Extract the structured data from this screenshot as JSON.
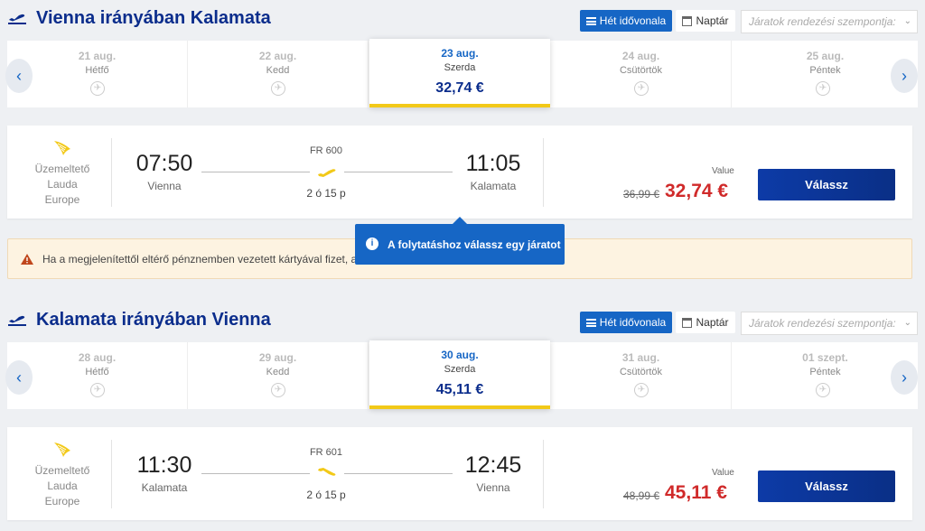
{
  "colors": {
    "brand_blue": "#0b2d8c",
    "accent_blue": "#1666c5",
    "price_red": "#d02a2a",
    "highlight_yellow": "#f2c918"
  },
  "view": {
    "timeline_label": "Hét idővonala",
    "calendar_label": "Naptár",
    "sort_placeholder": "Járatok rendezési szempontja:"
  },
  "outbound": {
    "title": "Vienna irányában Kalamata",
    "days": [
      {
        "date": "21 aug.",
        "weekday": "Hétfő"
      },
      {
        "date": "22 aug.",
        "weekday": "Kedd"
      },
      {
        "date": "23 aug.",
        "weekday": "Szerda",
        "price": "32,74 €",
        "selected": true
      },
      {
        "date": "24 aug.",
        "weekday": "Csütörtök"
      },
      {
        "date": "25 aug.",
        "weekday": "Péntek"
      }
    ],
    "flight": {
      "operator": [
        "Üzemeltető",
        "Lauda",
        "Europe"
      ],
      "dep_time": "07:50",
      "dep_city": "Vienna",
      "flight_no": "FR 600",
      "duration": "2 ó 15 p",
      "arr_time": "11:05",
      "arr_city": "Kalamata",
      "fare_label": "Value",
      "old_price": "36,99 €",
      "price": "32,74 €",
      "select_label": "Válassz"
    }
  },
  "alert": {
    "text": "Ha a megjelenítettől eltérő pénznemben vezetett kártyával fizet, a"
  },
  "tooltip": {
    "text": "A folytatáshoz válassz egy járatot"
  },
  "inbound": {
    "title": "Kalamata irányában Vienna",
    "days": [
      {
        "date": "28 aug.",
        "weekday": "Hétfő"
      },
      {
        "date": "29 aug.",
        "weekday": "Kedd"
      },
      {
        "date": "30 aug.",
        "weekday": "Szerda",
        "price": "45,11 €",
        "selected": true
      },
      {
        "date": "31 aug.",
        "weekday": "Csütörtök"
      },
      {
        "date": "01 szept.",
        "weekday": "Péntek"
      }
    ],
    "flight": {
      "operator": [
        "Üzemeltető",
        "Lauda",
        "Europe"
      ],
      "dep_time": "11:30",
      "dep_city": "Kalamata",
      "flight_no": "FR 601",
      "duration": "2 ó 15 p",
      "arr_time": "12:45",
      "arr_city": "Vienna",
      "fare_label": "Value",
      "old_price": "48,99 €",
      "price": "45,11 €",
      "select_label": "Válassz"
    }
  }
}
